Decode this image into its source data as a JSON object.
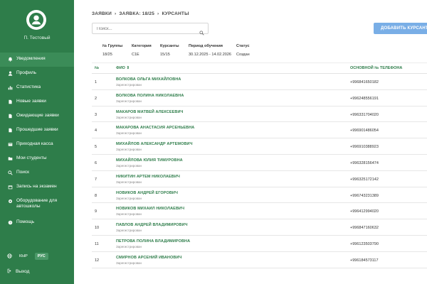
{
  "user": {
    "name": "П. Тестовый"
  },
  "nav": [
    {
      "label": "Уведомления",
      "icon": "bell-icon",
      "active": true
    },
    {
      "label": "Профиль",
      "icon": "user-icon"
    },
    {
      "label": "Статистика",
      "icon": "chart-icon"
    },
    {
      "label": "Новые заявки",
      "icon": "file-icon"
    },
    {
      "label": "Ожидающие заявки",
      "icon": "file-icon"
    },
    {
      "label": "Прошедшие заявки",
      "icon": "file-icon"
    },
    {
      "label": "Приходная касса",
      "icon": "cash-icon"
    },
    {
      "label": "Мои студенты",
      "icon": "folder-icon"
    },
    {
      "label": "Поиск",
      "icon": "search-icon"
    },
    {
      "label": "Запись на экзамен",
      "icon": "calendar-icon"
    },
    {
      "label": "Оборудование для автошколы",
      "icon": "gear-icon"
    },
    {
      "label": "Помощь",
      "icon": "help-icon"
    }
  ],
  "lang": {
    "options": [
      "КЫР",
      "РУС"
    ],
    "selected": "РУС"
  },
  "logout": "Выход",
  "breadcrumb": [
    "ЗАЯВКИ",
    "›",
    "ЗАЯВКА: 18/25",
    "›",
    "КУРСАНТЫ"
  ],
  "search": {
    "placeholder": "Поиск..."
  },
  "add_button": "ДОБАВИТЬ КУРСАНТА",
  "info": {
    "headers": [
      "№ Группы",
      "Категория",
      "Курсанты",
      "Период обучения",
      "Статус"
    ],
    "values": [
      "18/25",
      "C1E",
      "15/15",
      "30.12.2025 - 14.02.2026",
      "Создан"
    ]
  },
  "table": {
    "headers": {
      "num": "№",
      "name": "ФИО ⇕",
      "phone": "ОСНОВНОЙ № ТЕЛЕФОНА"
    },
    "rows": [
      {
        "num": "1",
        "name": "ВОЛКОВА ОЛЬГА МИХАЙЛОВНА",
        "status": "Зарегистрирован",
        "phone": "+996841650182"
      },
      {
        "num": "2",
        "name": "ВОЛКОВА ПОЛИНА НИКОЛАЕВНА",
        "status": "Зарегистрирован",
        "phone": "+996248556191"
      },
      {
        "num": "3",
        "name": "МАКАРОВ МАТВЕЙ АЛЕКСЕЕВИЧ",
        "status": "Зарегистрирован",
        "phone": "+996331704020"
      },
      {
        "num": "4",
        "name": "МАКАРОВА АНАСТАСИЯ АРСЕНЬЕВНА",
        "status": "Зарегистрирован",
        "phone": "+996901486054"
      },
      {
        "num": "5",
        "name": "МИХАЙЛОВ АЛЕКСАНДР АРТЕМОВИЧ",
        "status": "Зарегистрирован",
        "phone": "+996910388923"
      },
      {
        "num": "6",
        "name": "МИХАЙЛОВА ЮЛИЯ ТИМУРОВНА",
        "status": "Зарегистрирован",
        "phone": "+996328156474"
      },
      {
        "num": "7",
        "name": "НИКИТИН АРТЕМ НИКОЛАЕВИЧ",
        "status": "Зарегистрирован",
        "phone": "+996325172142"
      },
      {
        "num": "8",
        "name": "НОВИКОВ АНДРЕЙ ЕГОРОВИЧ",
        "status": "Зарегистрирован",
        "phone": "+996743231389"
      },
      {
        "num": "9",
        "name": "НОВИКОВ МИХАИЛ НИКОЛАЕВИЧ",
        "status": "Зарегистрирован",
        "phone": "+996412994020"
      },
      {
        "num": "10",
        "name": "ПАВЛОВ АНДРЕЙ ВЛАДИМИРОВИЧ",
        "status": "Зарегистрирован",
        "phone": "+996847160632"
      },
      {
        "num": "11",
        "name": "ПЕТРОВА ПОЛИНА ВЛАДИМИРОВНА",
        "status": "Зарегистрирован",
        "phone": "+996123503790"
      },
      {
        "num": "12",
        "name": "СМИРНОВ АРСЕНИЙ ИВАНОВИЧ",
        "status": "Зарегистрирован",
        "phone": "+996184573117"
      }
    ]
  }
}
